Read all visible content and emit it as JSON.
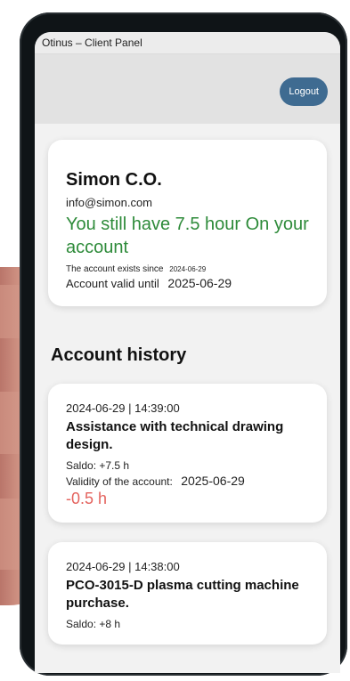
{
  "window": {
    "title": "Otinus – Client Panel"
  },
  "header": {
    "logout_label": "Logout"
  },
  "account": {
    "name": "Simon C.O.",
    "email": "info@simon.com",
    "hours_text": "You still have 7.5 hour On your account",
    "exists_label": "The account exists since",
    "exists_date": "2024-06-29",
    "valid_label": "Account valid until",
    "valid_date": "2025-06-29"
  },
  "history": {
    "title": "Account history",
    "items": [
      {
        "date": "2024-06-29",
        "time": "14:39:00",
        "description": "Assistance with technical drawing design.",
        "saldo": "Saldo: +7.5 h",
        "validity_label": "Validity of the account:",
        "validity_date": "2025-06-29",
        "delta": "-0.5 h"
      },
      {
        "date": "2024-06-29",
        "time": "14:38:00",
        "description": "PCO-3015-D plasma cutting machine purchase.",
        "saldo": "Saldo: +8 h"
      }
    ]
  },
  "colors": {
    "accent": "#3f6b91",
    "hours_green": "#2e8b3a",
    "delta_red": "#e4635e",
    "background": "#f2f2f2"
  }
}
